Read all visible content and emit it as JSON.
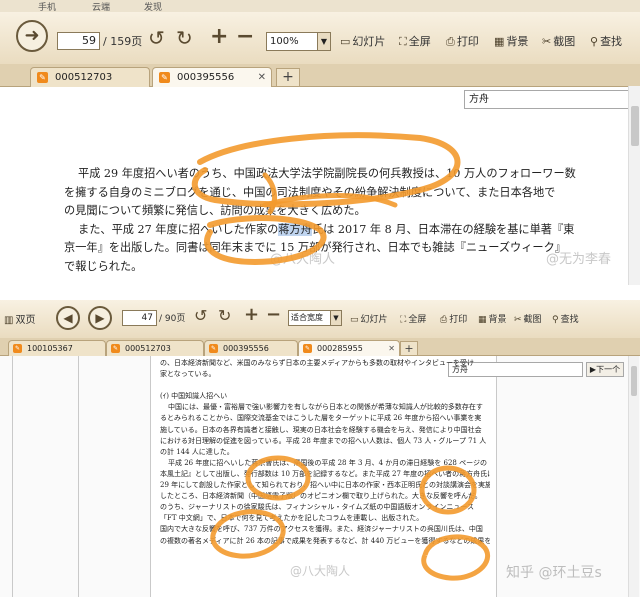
{
  "top": {
    "menu": [
      "手机",
      "云端",
      "发现"
    ],
    "page_current": "59",
    "page_total": "/ 159页",
    "zoom": "100%",
    "tools": [
      {
        "icon": "slideshow-icon",
        "label": "幻灯片"
      },
      {
        "icon": "fullscreen-icon",
        "label": "全屏"
      },
      {
        "icon": "print-icon",
        "label": "打印"
      },
      {
        "icon": "background-icon",
        "label": "背景"
      },
      {
        "icon": "screenshot-icon",
        "label": "截图"
      },
      {
        "icon": "find-icon",
        "label": "查找"
      }
    ],
    "tabs": [
      "000512703",
      "000395556"
    ],
    "search_value": "方舟",
    "paragraphs": [
      [
        "平成 29 年度招へい者のうち、中国政法大学法学院副院長の何兵教授は、10 万人のフォローワー数"
      ],
      [
        "を擁する自身のミニブログを通じ、中国の司法制度やその紛争解決制度について、また日本各地で"
      ],
      [
        "の見聞について頻繁に発信し、訪問の成果を大きく広めた。"
      ],
      [
        "また、平成 27 年度に招へいした作家の",
        "蒋方舟",
        "氏は 2017 年 8 月、日本滞在の経験を基に単著『東"
      ],
      [
        "京一年』を出版した。同書は同年末までに 15 万部が発行され、日本でも雑誌『ニューズウィーク』"
      ],
      [
        "で報じられた。"
      ]
    ],
    "watermark": "@八大陶人",
    "watermark2": "@无为李春"
  },
  "bottom": {
    "view_label": "双页",
    "page_current": "47",
    "page_total": "/ 90页",
    "zoom": "适合宽度",
    "tools": [
      {
        "icon": "slideshow-icon",
        "label": "幻灯片"
      },
      {
        "icon": "fullscreen-icon",
        "label": "全屏"
      },
      {
        "icon": "print-icon",
        "label": "打印"
      },
      {
        "icon": "background-icon",
        "label": "背景"
      },
      {
        "icon": "screenshot-icon",
        "label": "截图"
      },
      {
        "icon": "find-icon",
        "label": "查找"
      }
    ],
    "tabs": [
      "100105367",
      "000512703",
      "000395556",
      "000285955"
    ],
    "search_value": "方舟",
    "find_next": "下一个",
    "lines": [
      "の、日本経済新聞など、米国のみならず日本の主要メディアからも多数の取材やインタビューを受け",
      "家となっている。",
      "",
      "(ｲ) 中国知識人招へい",
      "中国には、最優・富裕層で強い影響力を有しながら日本との関係が希薄な知識人が比較的多数存在す",
      "るとみられることから、国際交流基金ではこうした層をターゲットに平成 26 年度から招へい事業を実",
      "施している。日本の各界有識者と接触し、現実の日本社会を経験する機会を与え、発信により中国社会",
      "における対日理解の促進を図っている。平成 28 年度までの招へい人数は、個人 73 人・グループ 71 人",
      "の計 144 人に達した。",
      "平成 26 年度に招へいした蒋宗曹氏は、帰国後の平成 28 年 3 月、4 か月の滞日経験を 628 ページの『日",
      "本風土記』として出版し、発行部数は 10 万部を記録するなど。また平成 27 年度の招へい者の蒋方舟氏は",
      "29 年にして創設した作家として知られており、招へい中に日本の作家・西本正明氏との対談講演会を実施",
      "したところ、日本経済新聞（中国語電子版）のオピニオン欄で取り上げられた。大きな反響を呼んだ。",
      "のうち、ジャーナリストの徐家駿氏は、フィナンシャル・タイムズ紙の中国語版オンラインニュース",
      "「FT 中文網」で、日本で何を見て考えたかを記したコラムを連載し、出版された。",
      "国内で大きな反響を呼び、737 万件のアクセスを獲得。また、経済ジャーナリストの呉国川氏は、中国",
      "の複数の著名メディアに計 26 本の記事で成果を発表するなど、計 440 万ビューを獲得するなどの成果を集め"
    ],
    "watermark": "@八大陶人",
    "watermark2": "知乎 @环土豆s"
  }
}
